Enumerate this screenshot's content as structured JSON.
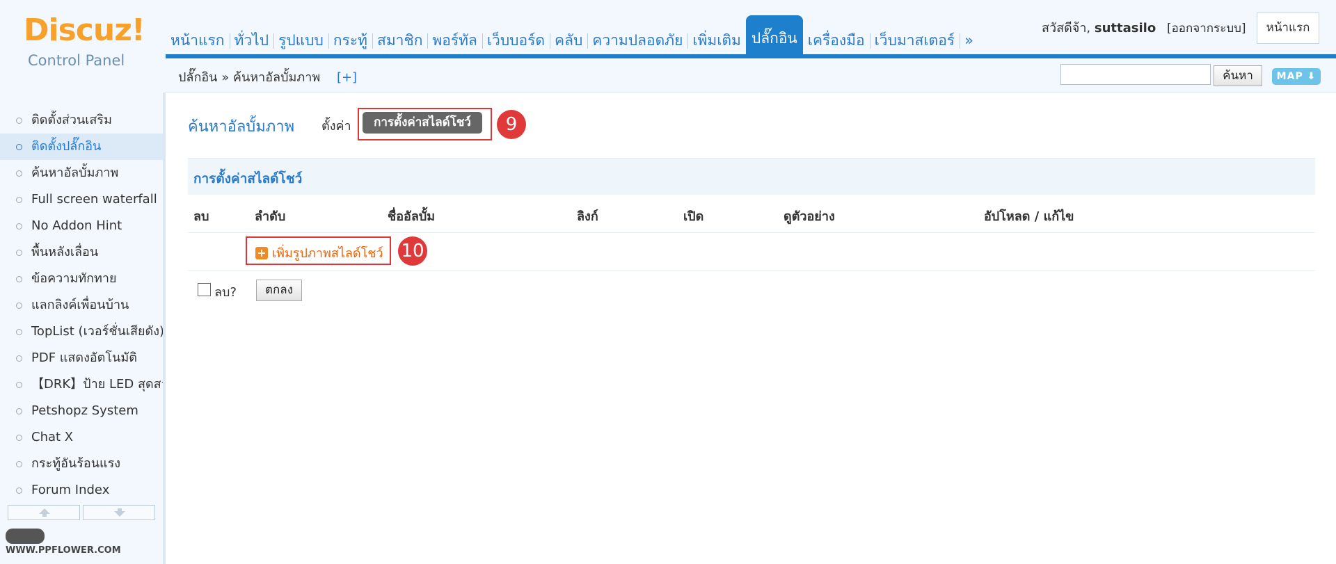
{
  "logo": {
    "brand": "Discuz!",
    "subtitle": "Control Panel"
  },
  "nav": {
    "tabs": [
      {
        "label": "หน้าแรก"
      },
      {
        "label": "ทั่วไป"
      },
      {
        "label": "รูปแบบ"
      },
      {
        "label": "กระทู้"
      },
      {
        "label": "สมาชิก"
      },
      {
        "label": "พอร์ทัล"
      },
      {
        "label": "เว็บบอร์ด"
      },
      {
        "label": "คลับ"
      },
      {
        "label": "ความปลอดภัย"
      },
      {
        "label": "เพิ่มเติม"
      },
      {
        "label": "ปลั๊กอิน"
      },
      {
        "label": "เครื่องมือ"
      },
      {
        "label": "เว็บมาสเตอร์"
      },
      {
        "label": "»"
      }
    ],
    "active_tab": "ปลั๊กอิน"
  },
  "user": {
    "greeting": "สวัสดีจ้า,",
    "username": "suttasilo",
    "logout": "[ออกจากระบบ]",
    "home_button": "หน้าแรก"
  },
  "breadcrumb": {
    "text": "ปลั๊กอิน » ค้นหาอัลบั้มภาพ",
    "add": "[+]"
  },
  "search": {
    "value": "",
    "button": "ค้นหา",
    "map_button": "MAP"
  },
  "sidebar": {
    "items": [
      {
        "label": "ติดตั้งส่วนเสริม"
      },
      {
        "label": "ติดตั้งปลั๊กอิน"
      },
      {
        "label": "ค้นหาอัลบั้มภาพ"
      },
      {
        "label": "Full screen waterfall"
      },
      {
        "label": "No Addon Hint"
      },
      {
        "label": "พื้นหลังเลื่อน"
      },
      {
        "label": "ข้อความทักทาย"
      },
      {
        "label": "แลกลิงค์เพื่อนบ้าน"
      },
      {
        "label": "TopList (เวอร์ชั่นเสียดัง)"
      },
      {
        "label": "PDF แสดงอัตโนมัติ"
      },
      {
        "label": "【DRK】ป้าย LED สุดสวย"
      },
      {
        "label": "Petshopz System"
      },
      {
        "label": "Chat X"
      },
      {
        "label": "กระทู้อันร้อนแรง"
      },
      {
        "label": "Forum Index"
      }
    ],
    "active_index": 1,
    "watermark": "WWW.PPFLOWER.COM"
  },
  "main": {
    "title": "ค้นหาอัลบั้มภาพ",
    "settings_link": "ตั้งค่า",
    "slideshow_button": "การตั้งค่าสไลด์โชว์",
    "badge_9": "9",
    "section_header": "การตั้งค่าสไลด์โชว์",
    "columns": [
      "ลบ",
      "ลำดับ",
      "ชื่ออัลบั้ม",
      "ลิงก์",
      "เปิด",
      "ดูตัวอย่าง",
      "อัปโหลด / แก้ไข"
    ],
    "add_slide": "เพิ่มรูปภาพสไลด์โชว์",
    "badge_10": "10",
    "delete_label": "ลบ?",
    "ok_button": "ตกลง"
  },
  "colors": {
    "accent": "#1e7fcd",
    "link": "#2b7ac9",
    "annotation_red": "#e0363a",
    "add_orange": "#e8630a",
    "logo_orange": "#f7a12a"
  }
}
